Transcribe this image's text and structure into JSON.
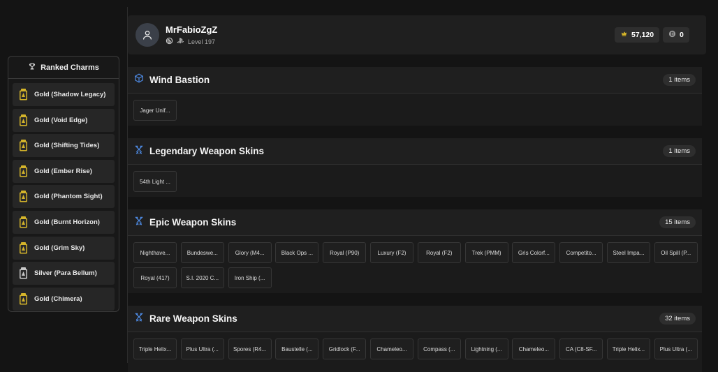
{
  "charms": {
    "title": "Ranked Charms",
    "items": [
      {
        "label": "Gold (Shadow Legacy)",
        "tier": "gold"
      },
      {
        "label": "Gold (Void Edge)",
        "tier": "gold"
      },
      {
        "label": "Gold (Shifting Tides)",
        "tier": "gold"
      },
      {
        "label": "Gold (Ember Rise)",
        "tier": "gold"
      },
      {
        "label": "Gold (Phantom Sight)",
        "tier": "gold"
      },
      {
        "label": "Gold (Burnt Horizon)",
        "tier": "gold"
      },
      {
        "label": "Gold (Grim Sky)",
        "tier": "gold"
      },
      {
        "label": "Silver (Para Bellum)",
        "tier": "silver"
      },
      {
        "label": "Gold (Chimera)",
        "tier": "gold"
      }
    ]
  },
  "profile": {
    "username": "MrFabioZgZ",
    "level": "Level 197",
    "credits": "57,120",
    "coins": "0"
  },
  "colors": {
    "gold": "#d4b42a",
    "silver": "#c9c9c9",
    "accent_blue": "#4f8de8"
  },
  "sections": [
    {
      "title": "Wind Bastion",
      "icon": "cube-icon",
      "count": "1 items",
      "items": [
        "Jager Unif..."
      ]
    },
    {
      "title": "Legendary Weapon Skins",
      "icon": "crossed-swords-icon",
      "count": "1 items",
      "items": [
        "54th Light ..."
      ]
    },
    {
      "title": "Epic Weapon Skins",
      "icon": "crossed-swords-icon",
      "count": "15 items",
      "items": [
        "Nighthave...",
        "Bundeswe...",
        "Glory (M4...",
        "Black Ops ...",
        "Royal (P90)",
        "Luxury (F2)",
        "Royal (F2)",
        "Trek (PMM)",
        "Gris Colorf...",
        "Competito...",
        "Steel Impa...",
        "Oil Spill (P...",
        "Royal (417)",
        "S.I. 2020 C...",
        "Iron Ship (..."
      ]
    },
    {
      "title": "Rare Weapon Skins",
      "icon": "crossed-swords-icon",
      "count": "32 items",
      "items": [
        "Triple Helix...",
        "Plus Ultra (...",
        "Spores (R4...",
        "Baustelle (...",
        "Gridlock (F...",
        "Chameleo...",
        "Compass (...",
        "Lightning (...",
        "Chameleo...",
        "CA (C8-SF...",
        "Triple Helix...",
        "Plus Ultra (..."
      ]
    }
  ]
}
